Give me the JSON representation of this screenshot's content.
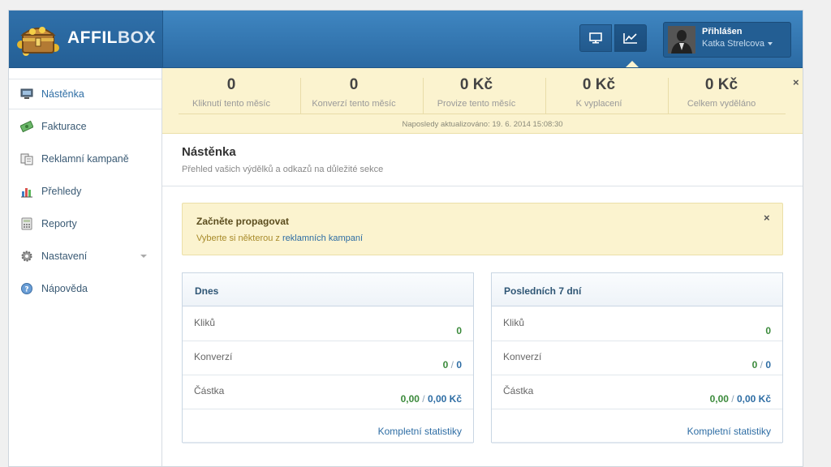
{
  "brand": {
    "logo_main": "AFFIL",
    "logo_accent": "BOX"
  },
  "header": {
    "buttons": [
      {
        "icon": "monitor-icon"
      },
      {
        "icon": "line-chart-icon",
        "active": true
      }
    ],
    "user": {
      "status": "Přihlášen",
      "name": "Katka Strelcova"
    }
  },
  "sidebar": {
    "items": [
      {
        "label": "Nástěnka",
        "icon": "monitor-icon",
        "active": true
      },
      {
        "label": "Fakturace",
        "icon": "money-icon"
      },
      {
        "label": "Reklamní kampaně",
        "icon": "campaigns-icon"
      },
      {
        "label": "Přehledy",
        "icon": "bar-chart-icon"
      },
      {
        "label": "Reporty",
        "icon": "calculator-icon"
      },
      {
        "label": "Nastavení",
        "icon": "gear-icon",
        "has_submenu": true
      },
      {
        "label": "Nápověda",
        "icon": "help-icon"
      }
    ]
  },
  "stats": {
    "items": [
      {
        "value": "0",
        "label": "Kliknutí tento měsíc"
      },
      {
        "value": "0",
        "label": "Konverzí tento měsíc"
      },
      {
        "value": "0 Kč",
        "label": "Provize tento měsíc"
      },
      {
        "value": "0 Kč",
        "label": "K vyplacení"
      },
      {
        "value": "0 Kč",
        "label": "Celkem vyděláno"
      }
    ],
    "updated": "Naposledy aktualizováno: 19. 6. 2014 15:08:30",
    "close": "×"
  },
  "page": {
    "title": "Nástěnka",
    "subtitle": "Přehled vašich výdělků a odkazů na důležité sekce"
  },
  "alert": {
    "title": "Začněte propagovat",
    "text": "Vyberte si některou z ",
    "link": "reklamních kampaní",
    "close": "×"
  },
  "panels": [
    {
      "title": "Dnes",
      "rows": {
        "clicks_label": "Kliků",
        "clicks": "0",
        "conv_label": "Konverzí",
        "conv_a": "0",
        "conv_b": "0",
        "amount_label": "Částka",
        "amount_a": "0,00",
        "amount_b": "0,00 Kč"
      },
      "link": "Kompletní statistiky"
    },
    {
      "title": "Posledních 7 dní",
      "rows": {
        "clicks_label": "Kliků",
        "clicks": "0",
        "conv_label": "Konverzí",
        "conv_a": "0",
        "conv_b": "0",
        "amount_label": "Částka",
        "amount_a": "0,00",
        "amount_b": "0,00 Kč"
      },
      "link": "Kompletní statistiky"
    }
  ],
  "colors": {
    "header": "#2f72ad",
    "highlight": "#fbf3cf",
    "positive": "#3b8a3b",
    "link": "#2e6da4"
  }
}
